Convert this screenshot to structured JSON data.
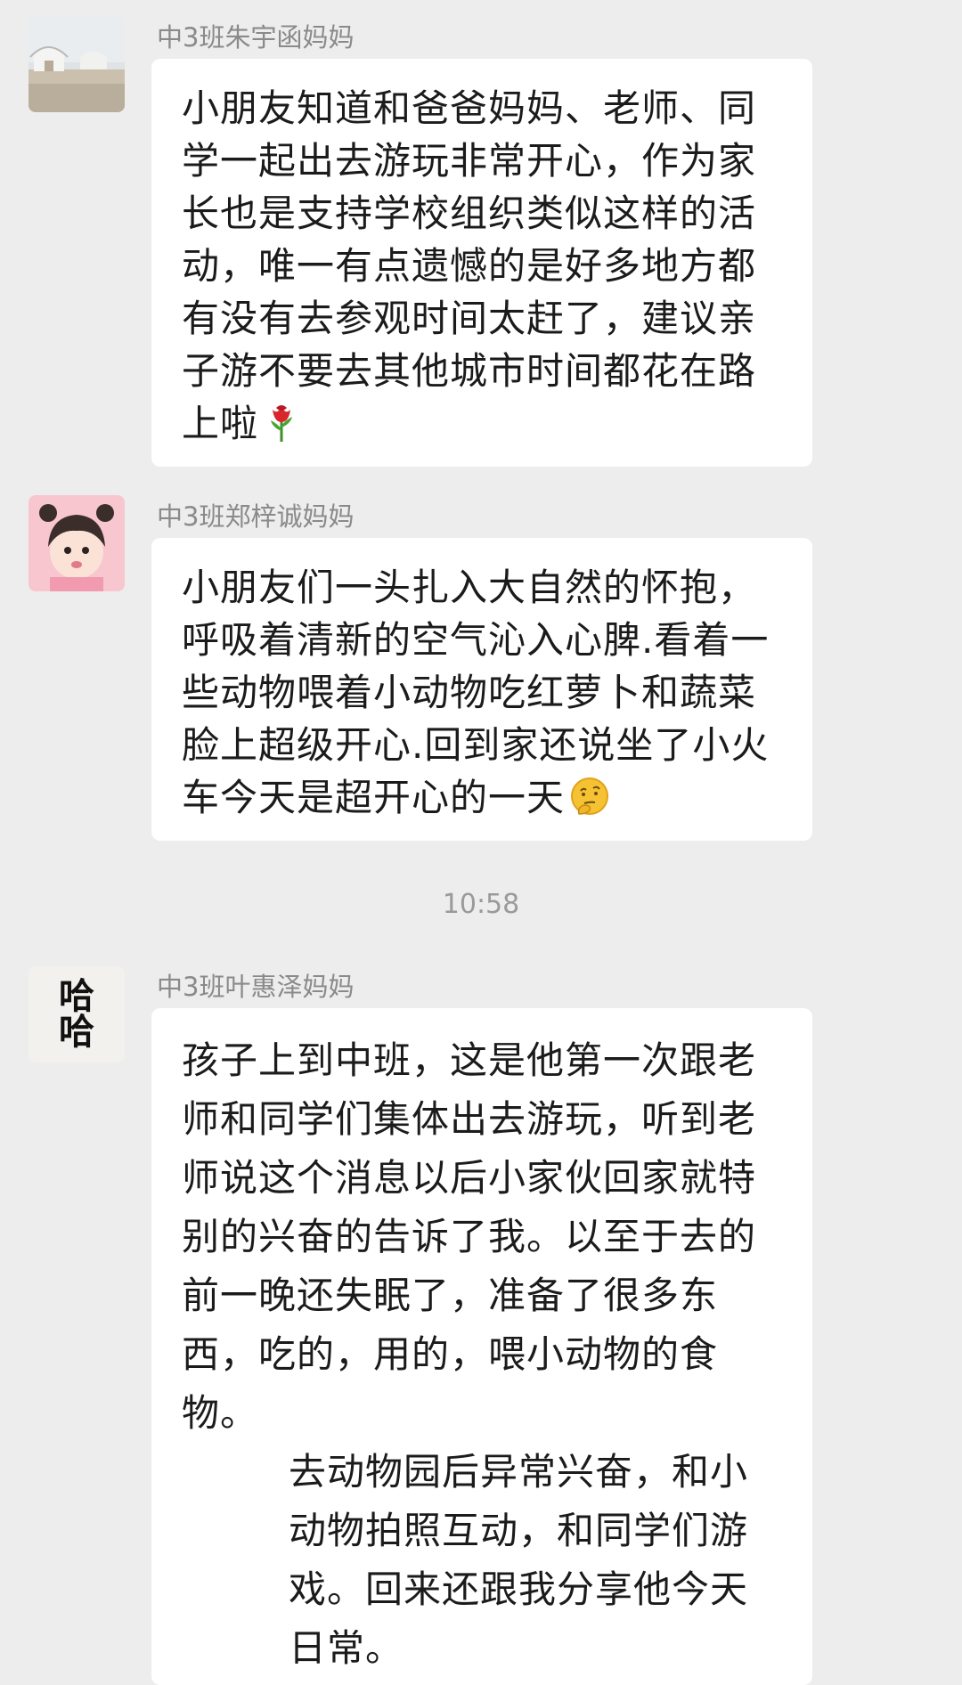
{
  "messages": [
    {
      "sender": "中3班朱宇函妈妈",
      "avatar_icon": "yurt-landscape-photo",
      "text": "小朋友知道和爸爸妈妈、老师、同学一起出去游玩非常开心，作为家长也是支持学校组织类似这样的活动，唯一有点遗憾的是好多地方都有没有去参观时间太赶了，建议亲子游不要去其他城市时间都花在路上啦",
      "emoji": "rose-icon"
    },
    {
      "sender": "中3班郑梓诚妈妈",
      "avatar_icon": "girl-photo",
      "text": "小朋友们一头扎入大自然的怀抱，呼吸着清新的空气沁入心脾.看着一些动物喂着小动物吃红萝卜和蔬菜脸上超级开心.回到家还说坐了小火车今天是超开心的一天",
      "emoji": "thinking-face-icon"
    },
    {
      "sender": "中3班叶惠泽妈妈",
      "avatar_icon": "haha-text-avatar",
      "avatar_text": "哈哈",
      "paragraphs": [
        "孩子上到中班，这是他第一次跟老师和同学们集体出去游玩，听到老师说这个消息以后小家伙回家就特别的兴奋的告诉了我。以至于去的前一晚还失眠了，准备了很多东西，吃的，用的，喂小动物的食物。",
        "去动物园后异常兴奋，和小动物拍照互动，和同学们游戏。回来还跟我分享他今天日常。"
      ]
    }
  ],
  "timestamp": "10:58"
}
